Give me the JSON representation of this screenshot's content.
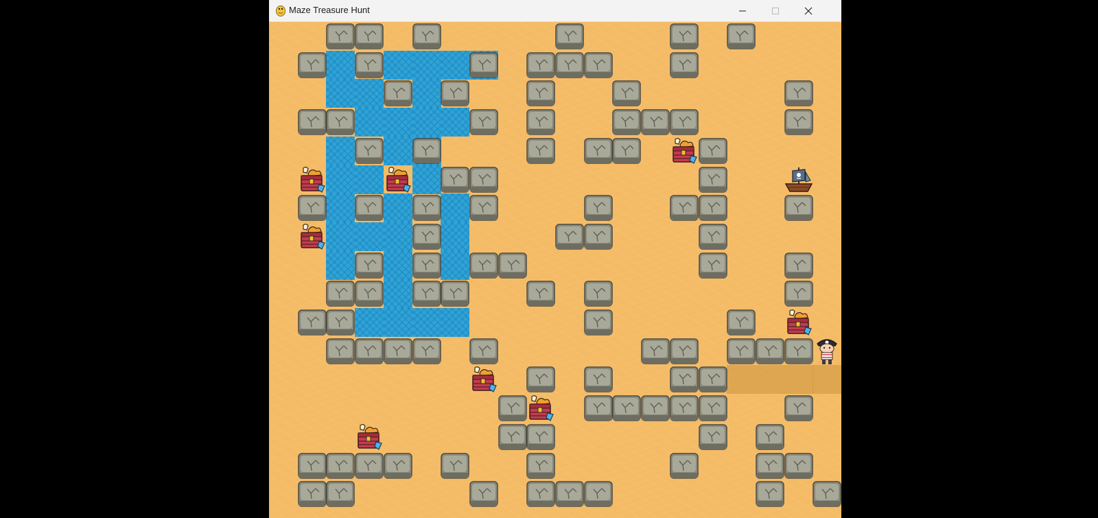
{
  "window": {
    "title": "Maze Treasure Hunt",
    "app_icon": "python-snake-icon",
    "controls": [
      "minimize-icon",
      "maximize-icon",
      "close-icon"
    ]
  },
  "colors": {
    "sand": "#f5bc68",
    "water": "#2fa3d6",
    "rock": "#8a8a7c",
    "rock_highlight": "#a9a99a",
    "chest": "#c33c4f",
    "desktop": "#000000"
  },
  "game": {
    "grid_cols": 20,
    "grid_rows": 18,
    "water_rows": [
      "....................",
      "..X.XXXX............",
      "..XX.X..............",
      "...XXXX.............",
      "..X.XX..............",
      "..XX.X..............",
      "..X.X.X.............",
      "..XXX.X.............",
      "..X.X.X.............",
      "....X...............",
      "...XXXX.............",
      "....................",
      "....................",
      "....................",
      "....................",
      "....................",
      "....................",
      "...................."
    ],
    "rock_rows": [
      "..XX.X....X...X.X...",
      ".X.X...X.XXX..X.....",
      "....X.X..X..X.....X.",
      ".XX....X.X..XXX...X.",
      "...X.X...X.XX..X....",
      "......XX.......X....",
      ".X.X.X.X...X..XX..X.",
      ".....X....XX...X....",
      "...X.X.XX......X..X.",
      "..XX.XX..X.X......X.",
      ".XX........X....X...",
      "..XXXX.X.....XX.XXX.",
      ".........X.X..XX....",
      "........X..XXXXX..X.",
      "........XX.....X.X..",
      ".XXXX.X..X....X..XX.",
      ".XX....X.XXX.....X.X"
    ],
    "chests": [
      {
        "col": 14,
        "row": 4
      },
      {
        "col": 1,
        "row": 5
      },
      {
        "col": 4,
        "row": 5
      },
      {
        "col": 1,
        "row": 7
      },
      {
        "col": 18,
        "row": 10
      },
      {
        "col": 7,
        "row": 12
      },
      {
        "col": 9,
        "row": 13
      },
      {
        "col": 3,
        "row": 14
      }
    ],
    "ship": {
      "col": 18,
      "row": 5,
      "icon": "pirate-ship-icon"
    },
    "player": {
      "col": 19,
      "row": 11,
      "icon": "pirate-player-icon"
    },
    "trail": [
      {
        "col": 16,
        "row": 12
      },
      {
        "col": 17,
        "row": 12
      },
      {
        "col": 18,
        "row": 12
      },
      {
        "col": 19,
        "row": 12
      }
    ],
    "collected_chest_icon": "treasure-chest-icon",
    "rock_icon": "rock-icon",
    "water_icon": "water-tile"
  }
}
